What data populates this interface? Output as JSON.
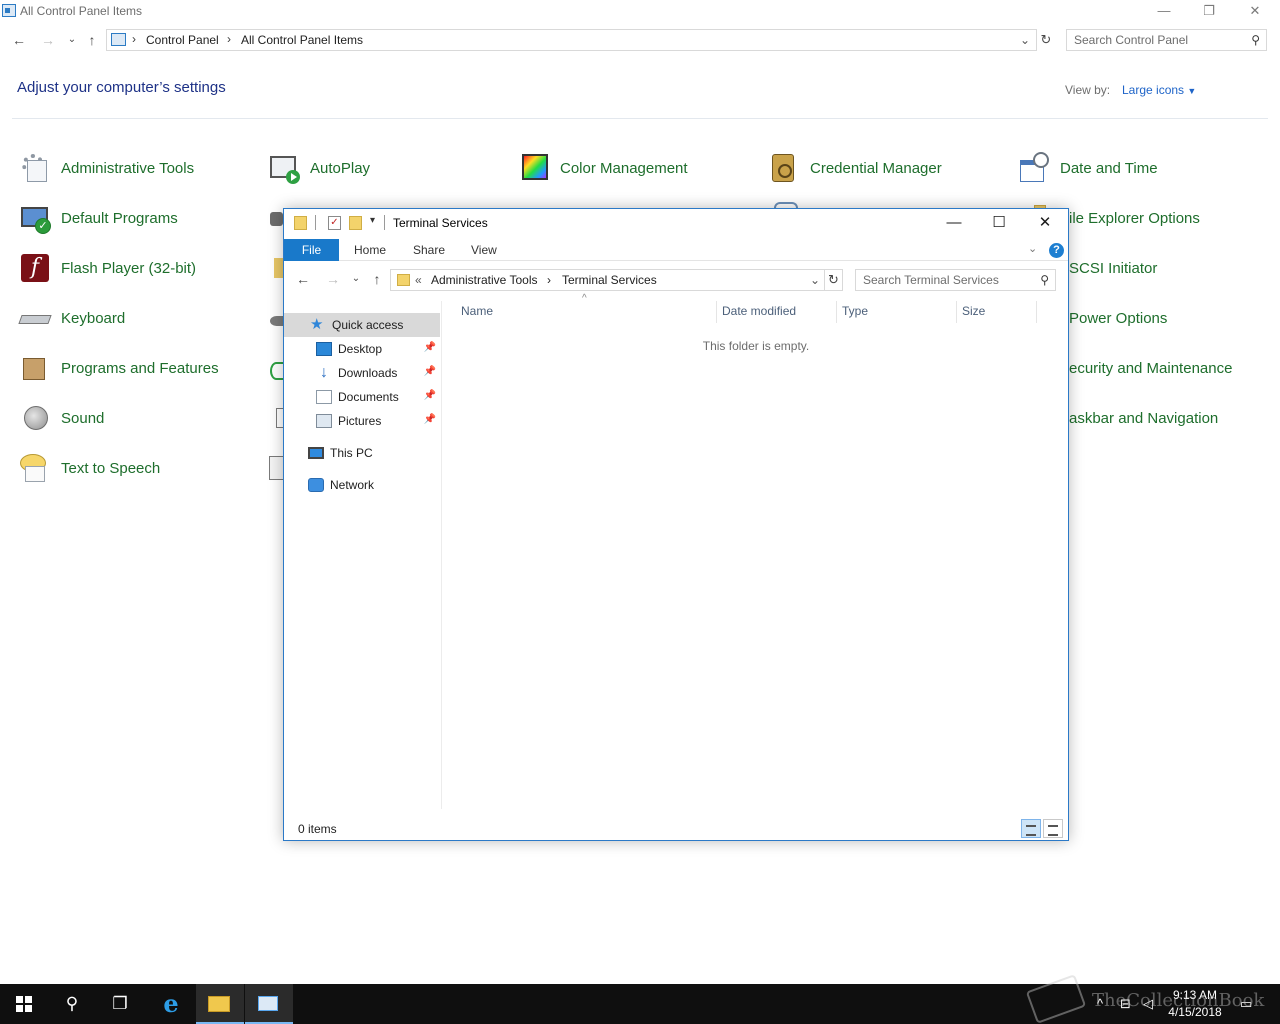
{
  "control_panel": {
    "window_title": "All Control Panel Items",
    "window_controls": {
      "minimize": "—",
      "restore": "❐",
      "close": "✕"
    },
    "breadcrumb": [
      "Control Panel",
      "All Control Panel Items"
    ],
    "search_placeholder": "Search Control Panel",
    "heading": "Adjust your computer’s settings",
    "view_by_label": "View by:",
    "view_by_value": "Large icons",
    "items_col1": [
      {
        "label": "Administrative Tools",
        "icon": "admin-tools-icon"
      },
      {
        "label": "Default Programs",
        "icon": "default-programs-icon"
      },
      {
        "label": "Flash Player (32-bit)",
        "icon": "flash-player-icon"
      },
      {
        "label": "Keyboard",
        "icon": "keyboard-icon"
      },
      {
        "label": "Programs and Features",
        "icon": "programs-features-icon"
      },
      {
        "label": "Sound",
        "icon": "sound-icon"
      },
      {
        "label": "Text to Speech",
        "icon": "text-to-speech-icon"
      }
    ],
    "items_row1": [
      {
        "label": "AutoPlay",
        "icon": "autoplay-icon"
      },
      {
        "label": "Color Management",
        "icon": "color-management-icon"
      },
      {
        "label": "Credential Manager",
        "icon": "credential-manager-icon"
      },
      {
        "label": "Date and Time",
        "icon": "date-time-icon"
      }
    ],
    "items_col5_partial": [
      "ile Explorer Options",
      "SCSI Initiator",
      "Power Options",
      "ecurity and Maintenance",
      "askbar and Navigation"
    ]
  },
  "explorer": {
    "window_title": "Terminal Services",
    "window_controls": {
      "minimize": "—",
      "maximize": "☐",
      "close": "✕"
    },
    "ribbon_tabs": {
      "file": "File",
      "home": "Home",
      "share": "Share",
      "view": "View"
    },
    "help": "?",
    "address": {
      "prefix": "«",
      "segments": [
        "Administrative Tools",
        "Terminal Services"
      ]
    },
    "search_placeholder": "Search Terminal Services",
    "nav": {
      "quick_access": "Quick access",
      "pinned": [
        "Desktop",
        "Downloads",
        "Documents",
        "Pictures"
      ],
      "this_pc": "This PC",
      "network": "Network"
    },
    "columns": [
      "Name",
      "Date modified",
      "Type",
      "Size"
    ],
    "empty_message": "This folder is empty.",
    "status": "0 items"
  },
  "taskbar": {
    "time": "9:13 AM",
    "date": "4/15/2018",
    "watermark": "TheCollectionBook"
  }
}
